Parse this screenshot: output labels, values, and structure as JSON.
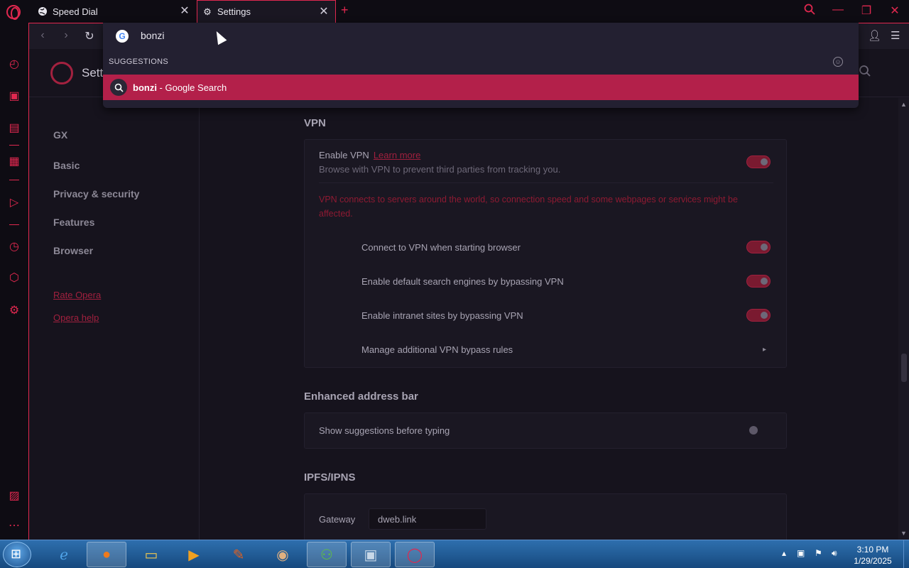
{
  "tabs": [
    {
      "label": "Speed Dial",
      "icon": "grid-icon"
    },
    {
      "label": "Settings",
      "icon": "gear-icon"
    }
  ],
  "address_bar": {
    "value": "bonzi"
  },
  "suggestions": {
    "header": "SUGGESTIONS",
    "items": [
      {
        "query": "bonzi",
        "suffix": " - Google Search"
      }
    ]
  },
  "settings": {
    "title": "Settings",
    "nav": [
      "GX",
      "Basic",
      "Privacy & security",
      "Features",
      "Browser"
    ],
    "links": [
      "Rate Opera",
      "Opera help"
    ],
    "vpn": {
      "section_title": "VPN",
      "enable_label": "Enable VPN",
      "learn_more": "Learn more",
      "enable_desc": "Browse with VPN to prevent third parties from tracking you.",
      "warning": "VPN connects to servers around the world, so connection speed and some webpages or services might be affected.",
      "options": [
        {
          "label": "Connect to VPN when starting browser",
          "enabled": true
        },
        {
          "label": "Enable default search engines by bypassing VPN",
          "enabled": true
        },
        {
          "label": "Enable intranet sites by bypassing VPN",
          "enabled": true
        }
      ],
      "manage_label": "Manage additional VPN bypass rules"
    },
    "address_bar_section": {
      "title": "Enhanced address bar",
      "option": "Show suggestions before typing",
      "enabled": false
    },
    "ipfs": {
      "title": "IPFS/IPNS",
      "gateway_label": "Gateway",
      "gateway_value": "dweb.link"
    }
  },
  "taskbar": {
    "time": "3:10 PM",
    "date": "1/29/2025"
  },
  "colors": {
    "accent": "#e0284f",
    "suggestion_bg": "#b3204a",
    "background": "#16131d"
  }
}
